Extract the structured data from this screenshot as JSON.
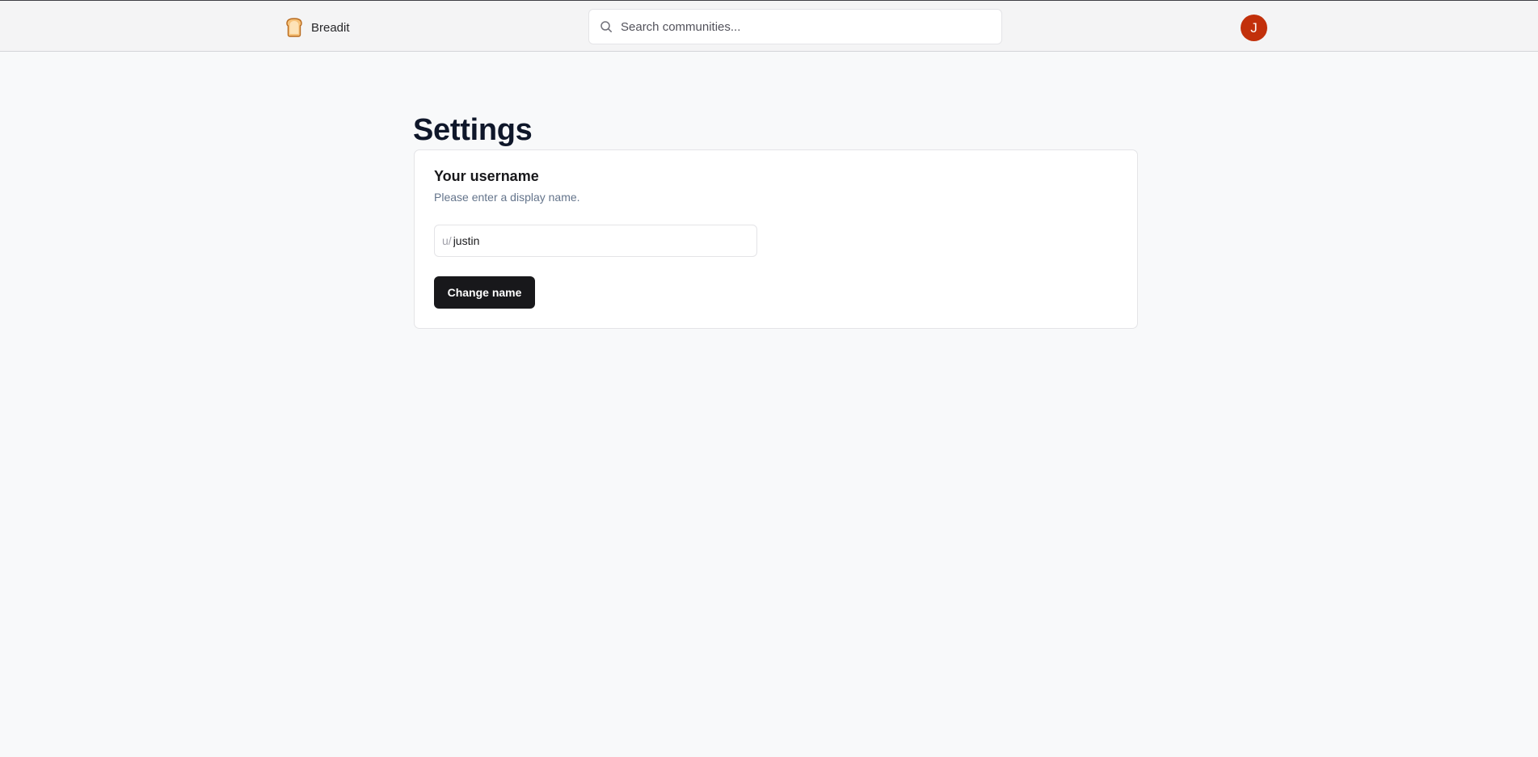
{
  "navbar": {
    "brand": {
      "icon": "bread-icon",
      "name": "Breadit"
    },
    "search": {
      "icon": "search-icon",
      "placeholder": "Search communities..."
    },
    "avatar": {
      "initial": "J",
      "color": "#c2300b"
    }
  },
  "settings": {
    "title": "Settings",
    "username_card": {
      "title": "Your username",
      "description": "Please enter a display name.",
      "prefix": "u/",
      "value": "justin",
      "button_label": "Change name"
    }
  },
  "colors": {
    "background": "#f8f9fa",
    "navbar": "#f4f4f5",
    "button": "#18181b",
    "avatar": "#c2300b"
  }
}
